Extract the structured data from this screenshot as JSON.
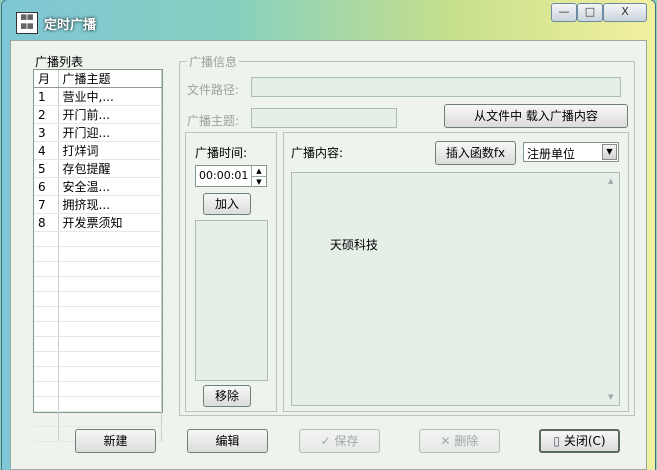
{
  "window": {
    "title": "定时广播",
    "minimize": "—",
    "maximize": "□",
    "close": "X"
  },
  "list_panel": {
    "label": "广播列表",
    "columns": [
      "月",
      "广播主题"
    ],
    "rows": [
      {
        "num": "1",
        "topic": "营业中,..."
      },
      {
        "num": "2",
        "topic": "开门前..."
      },
      {
        "num": "3",
        "topic": "开门迎..."
      },
      {
        "num": "4",
        "topic": "打烊词"
      },
      {
        "num": "5",
        "topic": "存包提醒"
      },
      {
        "num": "6",
        "topic": "安全温..."
      },
      {
        "num": "7",
        "topic": "拥挤现..."
      },
      {
        "num": "8",
        "topic": "开发票须知"
      }
    ]
  },
  "info": {
    "label": "广播信息",
    "file_path_label": "文件路径:",
    "file_path_value": "",
    "topic_label": "广播主题:",
    "topic_value": "",
    "load_button": "从文件中   载入广播内容"
  },
  "time_panel": {
    "label": "广播时间:",
    "time_value": "00:00:01",
    "add_button": "加入",
    "remove_button": "移除"
  },
  "content_panel": {
    "label": "广播内容:",
    "insert_button": "插入函数fx",
    "unit_select": "注册单位",
    "text": "天硕科技"
  },
  "footer": {
    "new_button": "新建",
    "edit_button": "编辑",
    "save_button": "保存",
    "delete_button": "删除",
    "close_button": "关闭(C)"
  }
}
